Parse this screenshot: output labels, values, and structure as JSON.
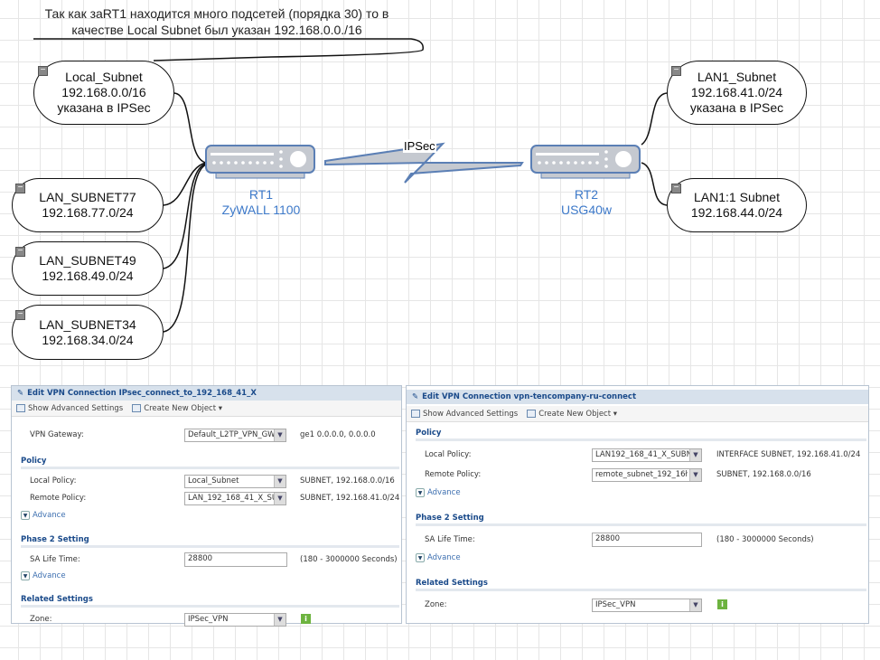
{
  "note": {
    "line1": "Так как заRT1 находится много подсетей (порядка 30) то в",
    "line2": "качестве Local Subnet был указан 192.168.0.0./16"
  },
  "left_nodes": [
    {
      "l1": "Local_Subnet",
      "l2": "192.168.0.0/16",
      "l3": "указана в IPSec"
    },
    {
      "l1": "LAN_SUBNET77",
      "l2": "192.168.77.0/24"
    },
    {
      "l1": "LAN_SUBNET49",
      "l2": "192.168.49.0/24"
    },
    {
      "l1": "LAN_SUBNET34",
      "l2": "192.168.34.0/24"
    }
  ],
  "right_nodes": [
    {
      "l1": "LAN1_Subnet",
      "l2": "192.168.41.0/24",
      "l3": "указана в IPSec"
    },
    {
      "l1": "LAN1:1 Subnet",
      "l2": "192.168.44.0/24"
    }
  ],
  "rt1": {
    "name": "RT1",
    "model": "ZyWALL 1100"
  },
  "rt2": {
    "name": "RT2",
    "model": "USG40w"
  },
  "link_label": "IPSec",
  "colors": {
    "device": "#c5c9d0",
    "device_border": "#5b7fb5",
    "label": "#3d79c9"
  },
  "panel1": {
    "title": "Edit VPN Connection IPsec_connect_to_192_168_41_X",
    "show_adv": "Show Advanced Settings",
    "create": "Create New Object",
    "vpn_gw_label": "VPN Gateway:",
    "vpn_gw": "Default_L2TP_VPN_GW",
    "vpn_gw_desc": "ge1   0.0.0.0, 0.0.0.0",
    "policy": "Policy",
    "local_label": "Local Policy:",
    "local": "Local_Subnet",
    "local_desc": "SUBNET, 192.168.0.0/16",
    "remote_label": "Remote Policy:",
    "remote": "LAN_192_168_41_X_SUBI",
    "remote_desc": "SUBNET, 192.168.41.0/24",
    "advance": "Advance",
    "phase2": "Phase 2 Setting",
    "sa_label": "SA Life Time:",
    "sa": "28800",
    "sa_desc": "(180 - 3000000 Seconds)",
    "related": "Related Settings",
    "zone_label": "Zone:",
    "zone": "IPSec_VPN"
  },
  "panel2": {
    "title": "Edit VPN Connection vpn-tencompany-ru-connect",
    "show_adv": "Show Advanced Settings",
    "create": "Create New Object",
    "policy": "Policy",
    "local_label": "Local Policy:",
    "local": "LAN192_168_41_X_SUBN",
    "local_desc": "INTERFACE SUBNET, 192.168.41.0/24",
    "remote_label": "Remote Policy:",
    "remote": "remote_subnet_192_16ł",
    "remote_desc": "SUBNET, 192.168.0.0/16",
    "advance": "Advance",
    "phase2": "Phase 2 Setting",
    "sa_label": "SA Life Time:",
    "sa": "28800",
    "sa_desc": "(180 - 3000000 Seconds)",
    "related": "Related Settings",
    "zone_label": "Zone:",
    "zone": "IPSec_VPN"
  }
}
